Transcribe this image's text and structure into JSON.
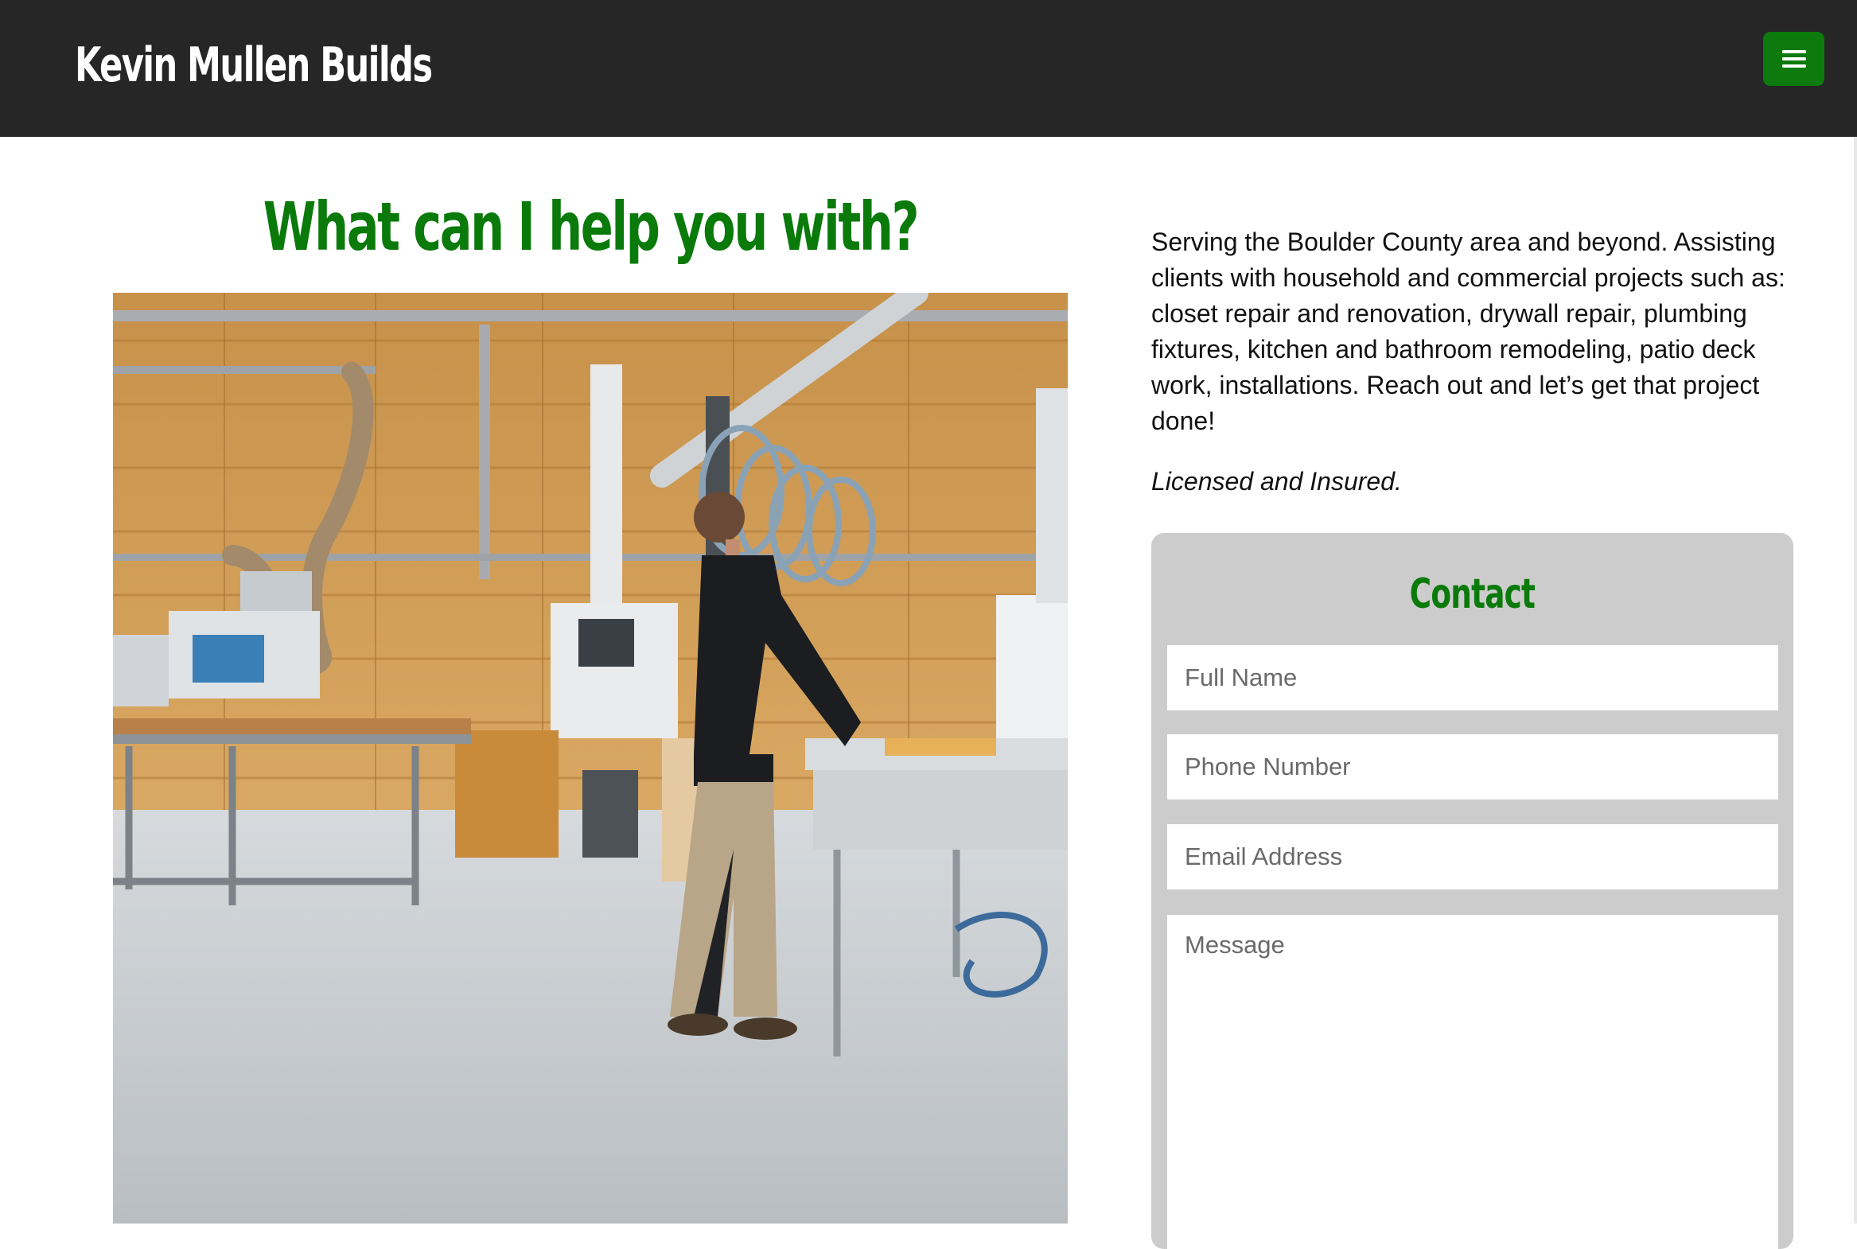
{
  "header": {
    "brand": "Kevin Mullen Builds",
    "menu_icon": "hamburger-menu-icon",
    "accent_color": "#0c7a0c",
    "background_color": "#262626"
  },
  "main": {
    "headline": "What can I help you with?",
    "headline_color": "#0a7a0a",
    "image": {
      "description": "woodworking-shop-photo"
    },
    "description": "Serving the Boulder County area and beyond. Assisting clients with household and commercial projects such as: closet repair and renovation, drywall repair, plumbing fixtures, kitchen and bathroom remodeling, patio deck work, installations. Reach out and let’s get that project done!",
    "licensed": "Licensed and Insured."
  },
  "contact": {
    "title": "Contact",
    "panel_color": "#cccccc",
    "fields": {
      "full_name_placeholder": "Full Name",
      "phone_placeholder": "Phone Number",
      "email_placeholder": "Email Address",
      "message_placeholder": "Message"
    }
  }
}
